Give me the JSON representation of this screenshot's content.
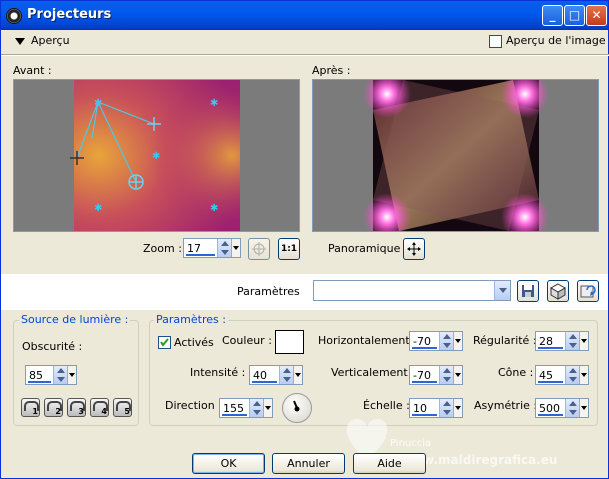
{
  "window": {
    "title": "Projecteurs",
    "buttons": {
      "minimize": "_",
      "maximize": "□",
      "close": "✕"
    }
  },
  "preview": {
    "toggle_label": "Aperçu",
    "image_preview_label": "Aperçu de l'image",
    "image_preview_checked": false,
    "before_label": "Avant :",
    "after_label": "Après :",
    "zoom_label": "Zoom :",
    "zoom_value": "17",
    "actual_size_label": "1:1",
    "pan_label": "Panoramique :"
  },
  "presets": {
    "label": "Paramètres",
    "value": ""
  },
  "light_source": {
    "title": "Source de lumière :",
    "darkness_label": "Obscurité :",
    "darkness_value": "85",
    "preset_numbers": [
      "1",
      "2",
      "3",
      "4",
      "5"
    ]
  },
  "params": {
    "title": "Paramètres :",
    "active_label": "Activés",
    "active_checked": true,
    "color_label": "Couleur :",
    "color_value": "#ffffff",
    "intensity_label": "Intensité :",
    "intensity_value": "40",
    "direction_label": "Direction :",
    "direction_value": "155",
    "horizontal_label": "Horizontalement :",
    "horizontal_value": "-70",
    "vertical_label": "Verticalement :",
    "vertical_value": "-70",
    "scale_label": "Échelle :",
    "scale_value": "10",
    "regularity_label": "Régularité :",
    "regularity_value": "28",
    "cone_label": "Cône :",
    "cone_value": "45",
    "asymmetry_label": "Asymétrie :",
    "asymmetry_value": "500"
  },
  "footer": {
    "ok_label": "OK",
    "cancel_label": "Annuler",
    "help_label": "Aide",
    "watermark_name": "Pinuccia",
    "watermark_url": "www.maldiregrafica.eu"
  },
  "colors": {
    "titlebar": "#0058ee",
    "accent_blue": "#0046d5",
    "before_gradient": [
      "#e8a53a",
      "#b52a6a",
      "#8a1f6a"
    ],
    "after_glow": "#ff4fd8"
  }
}
